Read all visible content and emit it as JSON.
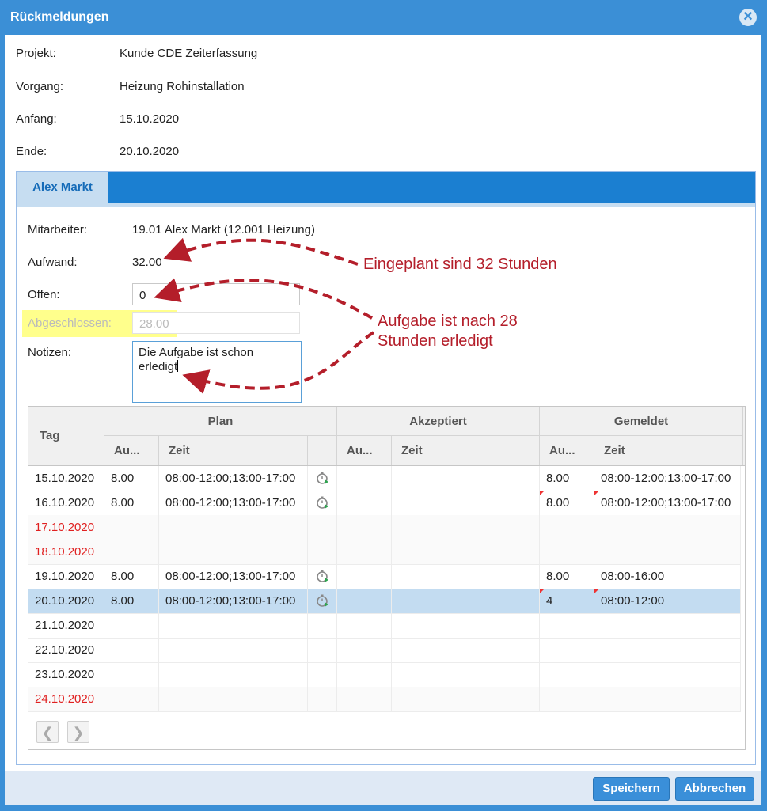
{
  "dialog": {
    "title": "Rückmeldungen",
    "close_icon": "close-icon"
  },
  "info": {
    "projekt_label": "Projekt:",
    "projekt_value": "Kunde CDE Zeiterfassung",
    "vorgang_label": "Vorgang:",
    "vorgang_value": "Heizung Rohinstallation",
    "anfang_label": "Anfang:",
    "anfang_value": "15.10.2020",
    "ende_label": "Ende:",
    "ende_value": "20.10.2020"
  },
  "tab": {
    "label": "Alex Markt"
  },
  "form": {
    "mitarbeiter_label": "Mitarbeiter:",
    "mitarbeiter_value": "19.01 Alex Markt (12.001 Heizung)",
    "aufwand_label": "Aufwand:",
    "aufwand_value": "32.00",
    "offen_label": "Offen:",
    "offen_value": "0",
    "abgeschlossen_label": "Abgeschlossen:",
    "abgeschlossen_value": "28.00",
    "notizen_label": "Notizen:",
    "notizen_line1": "Die Aufgabe ist schon",
    "notizen_line2": "erledigt"
  },
  "grid": {
    "tag_header": "Tag",
    "group_plan": "Plan",
    "group_akzeptiert": "Akzeptiert",
    "group_gemeldet": "Gemeldet",
    "sub_au": "Au...",
    "sub_zeit": "Zeit",
    "rows": [
      {
        "tag": "15.10.2020",
        "plan_au": "8.00",
        "plan_zeit": "08:00-12:00;13:00-17:00",
        "gem_au": "8.00",
        "gem_zeit": "08:00-12:00;13:00-17:00"
      },
      {
        "tag": "16.10.2020",
        "plan_au": "8.00",
        "plan_zeit": "08:00-12:00;13:00-17:00",
        "gem_au": "8.00",
        "gem_zeit": "08:00-12:00;13:00-17:00"
      },
      {
        "tag": "17.10.2020",
        "plan_au": "",
        "plan_zeit": "",
        "gem_au": "",
        "gem_zeit": ""
      },
      {
        "tag": "18.10.2020",
        "plan_au": "",
        "plan_zeit": "",
        "gem_au": "",
        "gem_zeit": ""
      },
      {
        "tag": "19.10.2020",
        "plan_au": "8.00",
        "plan_zeit": "08:00-12:00;13:00-17:00",
        "gem_au": "8.00",
        "gem_zeit": "08:00-16:00"
      },
      {
        "tag": "20.10.2020",
        "plan_au": "8.00",
        "plan_zeit": "08:00-12:00;13:00-17:00",
        "gem_au": "4",
        "gem_zeit": "08:00-12:00"
      },
      {
        "tag": "21.10.2020",
        "plan_au": "",
        "plan_zeit": "",
        "gem_au": "",
        "gem_zeit": ""
      },
      {
        "tag": "22.10.2020",
        "plan_au": "",
        "plan_zeit": "",
        "gem_au": "",
        "gem_zeit": ""
      },
      {
        "tag": "23.10.2020",
        "plan_au": "",
        "plan_zeit": "",
        "gem_au": "",
        "gem_zeit": ""
      },
      {
        "tag": "24.10.2020",
        "plan_au": "",
        "plan_zeit": "",
        "gem_au": "",
        "gem_zeit": ""
      }
    ]
  },
  "pager": {
    "prev": "❮",
    "next": "❯"
  },
  "footer": {
    "save_label": "Speichern",
    "cancel_label": "Abbrechen"
  },
  "annotations": {
    "text1": "Eingeplant sind 32 Stunden",
    "text2_line1": "Aufgabe ist nach 28",
    "text2_line2": "Stunden erledigt"
  },
  "colors": {
    "accent": "#3b8fd6",
    "tab_bar": "#1b7fd1",
    "annotation": "#b41e2a",
    "weekend_text": "#e02020",
    "highlight": "#ffff66"
  }
}
